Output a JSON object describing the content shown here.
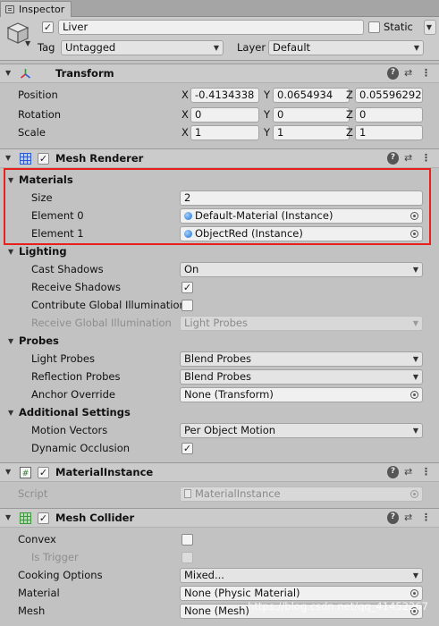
{
  "tab": {
    "label": "Inspector"
  },
  "object": {
    "name": "Liver",
    "static_label": "Static",
    "tag_label": "Tag",
    "tag_value": "Untagged",
    "layer_label": "Layer",
    "layer_value": "Default",
    "active": true,
    "static": false
  },
  "transform": {
    "title": "Transform",
    "rows": [
      {
        "label": "Position",
        "x": "-0.4134338",
        "y": "0.0654934",
        "z": "0.05596292"
      },
      {
        "label": "Rotation",
        "x": "0",
        "y": "0",
        "z": "0"
      },
      {
        "label": "Scale",
        "x": "1",
        "y": "1",
        "z": "1"
      }
    ],
    "axes": {
      "x": "X",
      "y": "Y",
      "z": "Z"
    }
  },
  "mesh_renderer": {
    "title": "Mesh Renderer",
    "materials": {
      "label": "Materials",
      "size_label": "Size",
      "size_value": "2",
      "elements": [
        {
          "label": "Element 0",
          "value": "Default-Material (Instance)"
        },
        {
          "label": "Element 1",
          "value": "ObjectRed (Instance)"
        }
      ]
    },
    "lighting": {
      "label": "Lighting",
      "cast_shadows_label": "Cast Shadows",
      "cast_shadows_value": "On",
      "receive_shadows_label": "Receive Shadows",
      "receive_shadows": true,
      "contribute_gi_label": "Contribute Global Illumination",
      "contribute_gi": false,
      "receive_gi_label": "Receive Global Illumination",
      "receive_gi_value": "Light Probes"
    },
    "probes": {
      "label": "Probes",
      "light_probes_label": "Light Probes",
      "light_probes_value": "Blend Probes",
      "reflection_probes_label": "Reflection Probes",
      "reflection_probes_value": "Blend Probes",
      "anchor_override_label": "Anchor Override",
      "anchor_override_value": "None (Transform)"
    },
    "additional": {
      "label": "Additional Settings",
      "motion_vectors_label": "Motion Vectors",
      "motion_vectors_value": "Per Object Motion",
      "dynamic_occlusion_label": "Dynamic Occlusion",
      "dynamic_occlusion": true
    }
  },
  "material_instance": {
    "title": "MaterialInstance",
    "script_label": "Script",
    "script_value": "MaterialInstance"
  },
  "mesh_collider": {
    "title": "Mesh Collider",
    "convex_label": "Convex",
    "convex": false,
    "is_trigger_label": "Is Trigger",
    "is_trigger": false,
    "cooking_label": "Cooking Options",
    "cooking_value": "Mixed...",
    "material_label": "Material",
    "material_value": "None (Physic Material)",
    "mesh_label": "Mesh",
    "mesh_value": "None (Mesh)"
  },
  "header_icons": {
    "help": "?",
    "presets": "⇄",
    "more": "⋮"
  },
  "watermark": "https://blog.csdn.net/qq_41452267",
  "colors": {
    "highlight_box": "#e8201c",
    "panel": "#c2c2c2",
    "header": "#cbcbcb"
  }
}
